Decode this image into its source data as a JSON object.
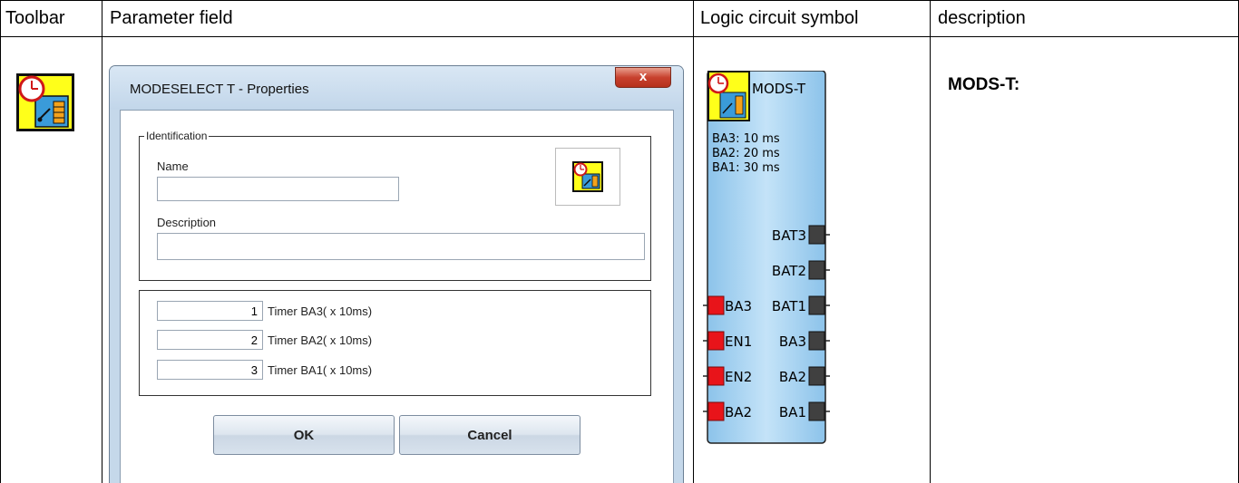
{
  "headers": {
    "toolbar": "Toolbar",
    "parameter_field": "Parameter field",
    "logic_symbol": "Logic circuit symbol",
    "description": "description"
  },
  "dialog": {
    "title": "MODESELECT T - Properties",
    "close_label": "x",
    "identification_legend": "Identification",
    "name_label": "Name",
    "name_value": "",
    "description_label": "Description",
    "description_value": "",
    "timers": [
      {
        "value": "1",
        "label": "Timer BA3( x 10ms)"
      },
      {
        "value": "2",
        "label": "Timer BA2( x 10ms)"
      },
      {
        "value": "3",
        "label": "Timer BA1( x 10ms)"
      }
    ],
    "ok_label": "OK",
    "cancel_label": "Cancel"
  },
  "symbol": {
    "title": "MODS-T",
    "params": [
      "BA3: 10 ms",
      "BA2: 20 ms",
      "BA1: 30 ms"
    ],
    "outputs": [
      "BAT3",
      "BAT2",
      "BAT1",
      "BA3",
      "BA2",
      "BA1"
    ],
    "inputs": [
      "BA3",
      "EN1",
      "EN2",
      "BA2"
    ],
    "input_color": "#e8141a",
    "output_color": "#404040",
    "body_color": "#a9d2f0"
  },
  "description_title": "MODS-T:"
}
